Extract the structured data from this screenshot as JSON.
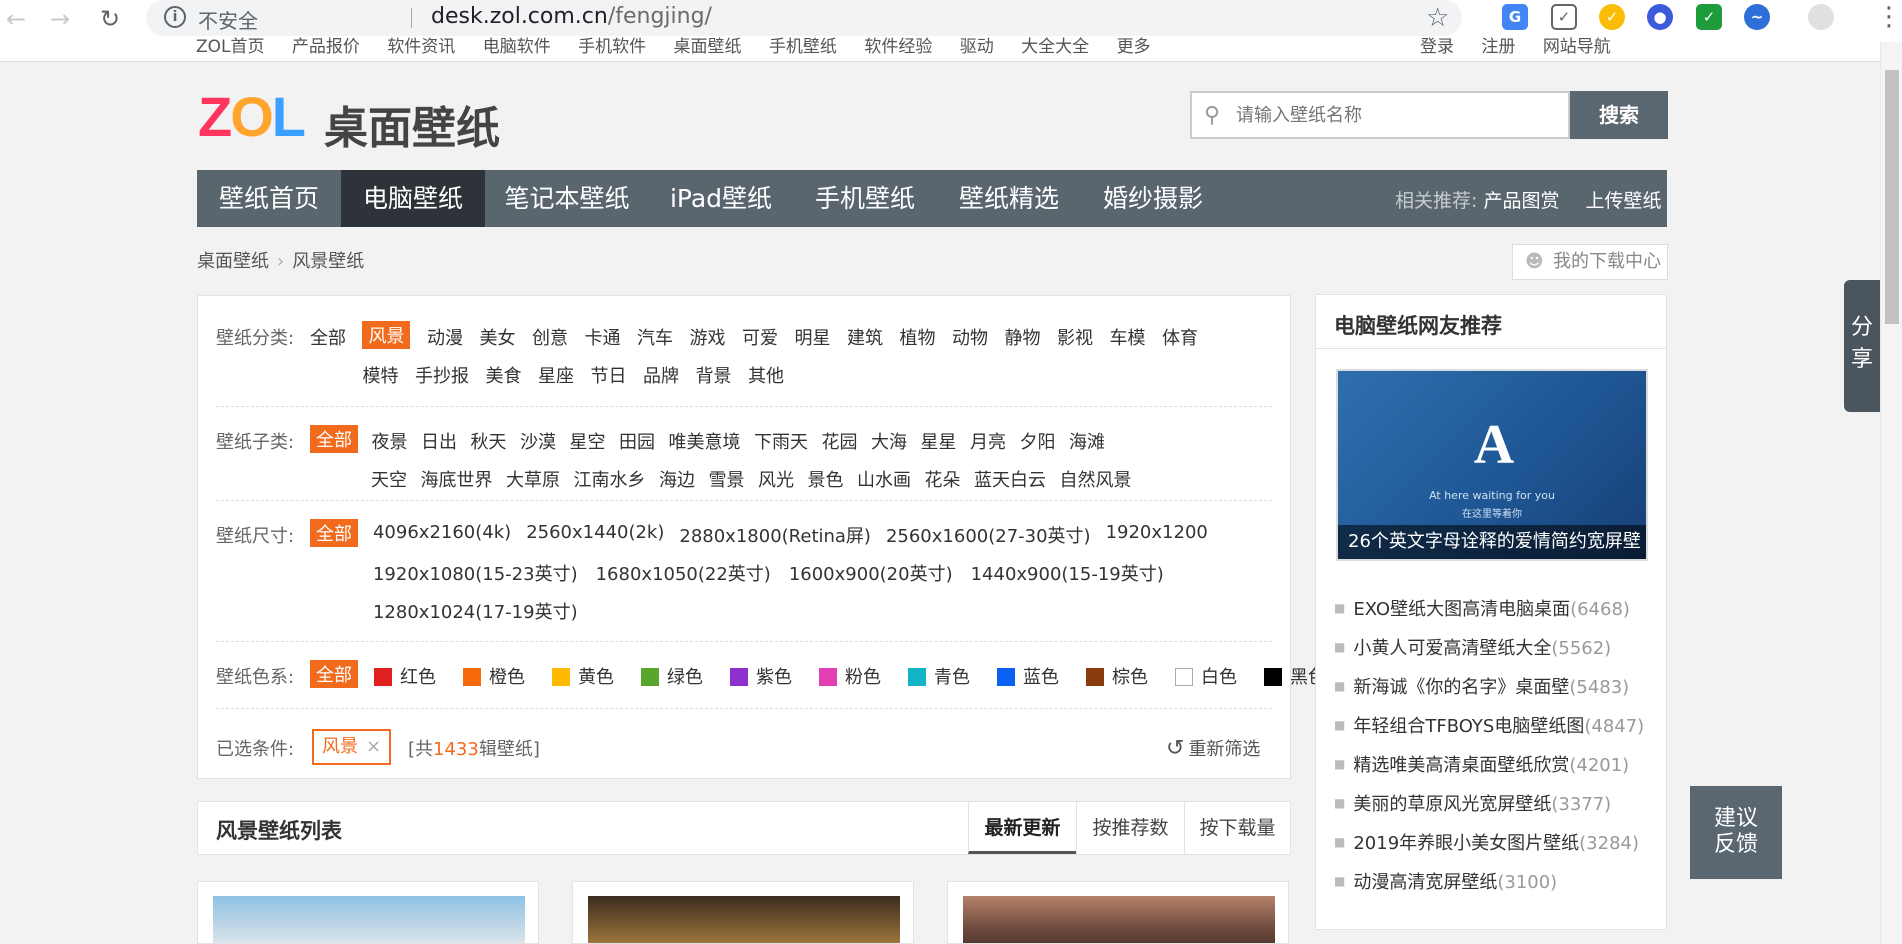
{
  "browser": {
    "insecure_label": "不安全",
    "url_host": "desk.zol.com.cn",
    "url_path": "/fengjing/"
  },
  "topnav": {
    "left_links": [
      "ZOL首页",
      "产品报价",
      "软件资讯",
      "电脑软件",
      "手机软件",
      "桌面壁纸",
      "手机壁纸",
      "软件经验",
      "驱动",
      "大全大全",
      "更多"
    ],
    "right_links": [
      "登录",
      "注册",
      "网站导航"
    ]
  },
  "logo": {
    "brand": "ZOL",
    "name": "桌面壁纸"
  },
  "search": {
    "placeholder": "请输入壁纸名称",
    "button": "搜索"
  },
  "mainnav": {
    "items": [
      "壁纸首页",
      "电脑壁纸",
      "笔记本壁纸",
      "iPad壁纸",
      "手机壁纸",
      "壁纸精选",
      "婚纱摄影"
    ],
    "active_index": 1,
    "related_label": "相关推荐:",
    "related_link": "产品图赏",
    "upload": "上传壁纸"
  },
  "breadcrumb": {
    "home": "桌面壁纸",
    "current": "风景壁纸"
  },
  "download_center": "我的下载中心",
  "filters": {
    "category": {
      "label": "壁纸分类:",
      "row1": [
        "全部",
        "风景",
        "动漫",
        "美女",
        "创意",
        "卡通",
        "汽车",
        "游戏",
        "可爱",
        "明星",
        "建筑",
        "植物",
        "动物",
        "静物",
        "影视",
        "车模",
        "体育"
      ],
      "row2": [
        "模特",
        "手抄报",
        "美食",
        "星座",
        "节日",
        "品牌",
        "背景",
        "其他"
      ],
      "selected": "风景"
    },
    "subcategory": {
      "label": "壁纸子类:",
      "row1": [
        "全部",
        "夜景",
        "日出",
        "秋天",
        "沙漠",
        "星空",
        "田园",
        "唯美意境",
        "下雨天",
        "花园",
        "大海",
        "星星",
        "月亮",
        "夕阳",
        "海滩"
      ],
      "row2": [
        "天空",
        "海底世界",
        "大草原",
        "江南水乡",
        "海边",
        "雪景",
        "风光",
        "景色",
        "山水画",
        "花朵",
        "蓝天白云",
        "自然风景"
      ],
      "selected": "全部"
    },
    "size": {
      "label": "壁纸尺寸:",
      "row1": [
        "全部",
        "4096x2160(4k)",
        "2560x1440(2k)",
        "2880x1800(Retina屏)",
        "2560x1600(27-30英寸)",
        "1920x1200"
      ],
      "row2": [
        "1920x1080(15-23英寸)",
        "1680x1050(22英寸)",
        "1600x900(20英寸)",
        "1440x900(15-19英寸)"
      ],
      "row3": [
        "1280x1024(17-19英寸)"
      ],
      "selected": "全部"
    },
    "color": {
      "label": "壁纸色系:",
      "all": "全部",
      "items": [
        {
          "name": "红色",
          "hex": "#e0201f"
        },
        {
          "name": "橙色",
          "hex": "#f76a0c"
        },
        {
          "name": "黄色",
          "hex": "#ffb900"
        },
        {
          "name": "绿色",
          "hex": "#5aa52c"
        },
        {
          "name": "紫色",
          "hex": "#8e2fd0"
        },
        {
          "name": "粉色",
          "hex": "#e23fb4"
        },
        {
          "name": "青色",
          "hex": "#13b4c6"
        },
        {
          "name": "蓝色",
          "hex": "#0c61f5"
        },
        {
          "name": "棕色",
          "hex": "#8a3c10"
        },
        {
          "name": "白色",
          "hex": "#ffffff"
        },
        {
          "name": "黑色",
          "hex": "#000000"
        }
      ]
    },
    "selected_row": {
      "label": "已选条件:",
      "chip": "风景",
      "count_prefix": "[共",
      "count": "1433",
      "count_suffix": "辑壁纸]",
      "reset": "重新筛选"
    }
  },
  "list": {
    "title": "风景壁纸列表",
    "tabs": [
      "最新更新",
      "按推荐数",
      "按下载量"
    ],
    "active_tab": "最新更新"
  },
  "sidebar": {
    "title": "电脑壁纸网友推荐",
    "featured": {
      "small_line1": "At here waiting for you",
      "small_line2": "在这里等着你",
      "caption": "26个英文字母诠释的爱情简约宽屏壁"
    },
    "items": [
      {
        "title": "EXO壁纸大图高清电脑桌面",
        "count": "(6468)"
      },
      {
        "title": "小黄人可爱高清壁纸大全",
        "count": "(5562)"
      },
      {
        "title": "新海诚《你的名字》桌面壁",
        "count": "(5483)"
      },
      {
        "title": "年轻组合TFBOYS电脑壁纸图",
        "count": "(4847)"
      },
      {
        "title": "精选唯美高清桌面壁纸欣赏",
        "count": "(4201)"
      },
      {
        "title": "美丽的草原风光宽屏壁纸",
        "count": "(3377)"
      },
      {
        "title": "2019年养眼小美女图片壁纸",
        "count": "(3284)"
      },
      {
        "title": "动漫高清宽屏壁纸",
        "count": "(3100)"
      }
    ]
  },
  "share": "分享",
  "feedback": [
    "建议",
    "反馈"
  ],
  "colors": {
    "accent": "#f26b1d",
    "nav_bg": "#59666e",
    "nav_active": "#2d3338"
  }
}
